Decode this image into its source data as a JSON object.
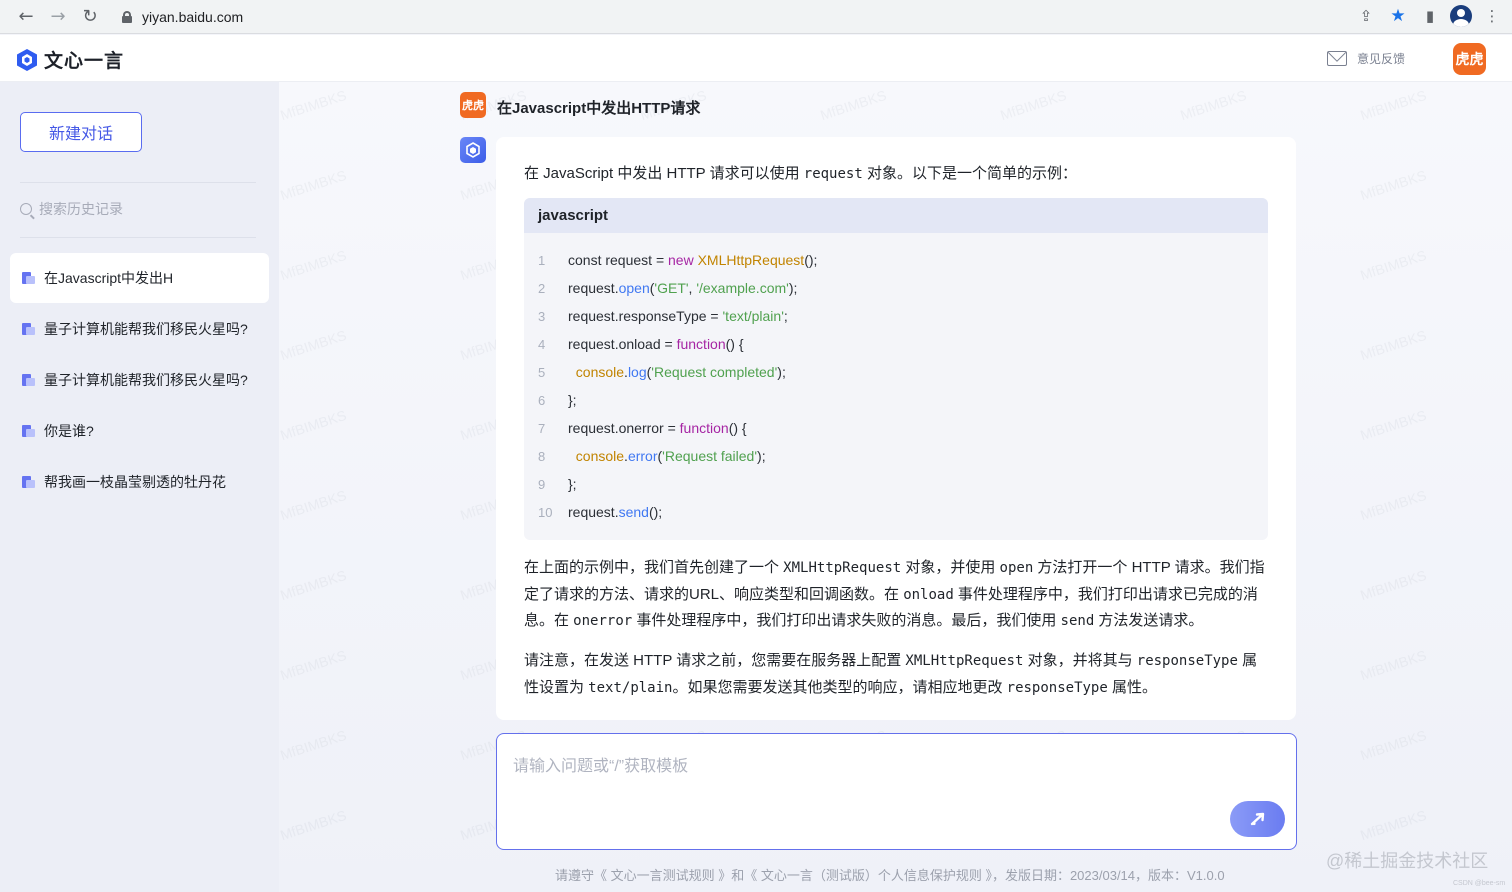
{
  "browser": {
    "url": "yiyan.baidu.com"
  },
  "header": {
    "logo_text": "文心一言",
    "feedback_label": "意见反馈",
    "avatar_text": "虎虎"
  },
  "sidebar": {
    "new_chat_label": "新建对话",
    "search_placeholder": "搜索历史记录",
    "items": [
      {
        "label": "在Javascript中发出H"
      },
      {
        "label": "量子计算机能帮我们移民火星吗?"
      },
      {
        "label": "量子计算机能帮我们移民火星吗?"
      },
      {
        "label": "你是谁?"
      },
      {
        "label": "帮我画一枝晶莹剔透的牡丹花"
      }
    ]
  },
  "conversation": {
    "question": "在Javascript中发出HTTP请求",
    "user_avatar_text": "虎虎",
    "answer": {
      "intro_a": "在 JavaScript 中发出 HTTP 请求可以使用 ",
      "intro_code": "request",
      "intro_b": " 对象。以下是一个简单的示例：",
      "code_lang": "javascript",
      "code_lines": [
        {
          "num": "1",
          "parts": [
            {
              "t": "const request = ",
              "c": ""
            },
            {
              "t": "new",
              "c": "kw"
            },
            {
              "t": " ",
              "c": ""
            },
            {
              "t": "XMLHttpRequest",
              "c": "cls"
            },
            {
              "t": "();",
              "c": ""
            }
          ]
        },
        {
          "num": "2",
          "parts": [
            {
              "t": "request.",
              "c": ""
            },
            {
              "t": "open",
              "c": "fn"
            },
            {
              "t": "(",
              "c": ""
            },
            {
              "t": "'GET'",
              "c": "str"
            },
            {
              "t": ", ",
              "c": ""
            },
            {
              "t": "'/example.com'",
              "c": "str"
            },
            {
              "t": ");",
              "c": ""
            }
          ]
        },
        {
          "num": "3",
          "parts": [
            {
              "t": "request.responseType = ",
              "c": ""
            },
            {
              "t": "'text/plain'",
              "c": "str"
            },
            {
              "t": ";",
              "c": ""
            }
          ]
        },
        {
          "num": "4",
          "parts": [
            {
              "t": "request.onload = ",
              "c": ""
            },
            {
              "t": "function",
              "c": "kw"
            },
            {
              "t": "() {",
              "c": ""
            }
          ]
        },
        {
          "num": "5",
          "parts": [
            {
              "t": "  ",
              "c": ""
            },
            {
              "t": "console",
              "c": "obj"
            },
            {
              "t": ".",
              "c": ""
            },
            {
              "t": "log",
              "c": "fn"
            },
            {
              "t": "(",
              "c": ""
            },
            {
              "t": "'Request completed'",
              "c": "str"
            },
            {
              "t": ");",
              "c": ""
            }
          ]
        },
        {
          "num": "6",
          "parts": [
            {
              "t": "};",
              "c": ""
            }
          ]
        },
        {
          "num": "7",
          "parts": [
            {
              "t": "request.onerror = ",
              "c": ""
            },
            {
              "t": "function",
              "c": "kw"
            },
            {
              "t": "() {",
              "c": ""
            }
          ]
        },
        {
          "num": "8",
          "parts": [
            {
              "t": "  ",
              "c": ""
            },
            {
              "t": "console",
              "c": "obj"
            },
            {
              "t": ".",
              "c": ""
            },
            {
              "t": "error",
              "c": "fn"
            },
            {
              "t": "(",
              "c": ""
            },
            {
              "t": "'Request failed'",
              "c": "str"
            },
            {
              "t": ");",
              "c": ""
            }
          ]
        },
        {
          "num": "9",
          "parts": [
            {
              "t": "};",
              "c": ""
            }
          ]
        },
        {
          "num": "10",
          "parts": [
            {
              "t": "request.",
              "c": ""
            },
            {
              "t": "send",
              "c": "fn"
            },
            {
              "t": "();",
              "c": ""
            }
          ]
        }
      ],
      "para1": [
        {
          "t": "在上面的示例中，我们首先创建了一个 ",
          "m": false
        },
        {
          "t": "XMLHttpRequest",
          "m": true
        },
        {
          "t": " 对象，并使用 ",
          "m": false
        },
        {
          "t": "open",
          "m": true
        },
        {
          "t": " 方法打开一个 HTTP 请求。我们指定了请求的方法、请求的URL、响应类型和回调函数。在 ",
          "m": false
        },
        {
          "t": "onload",
          "m": true
        },
        {
          "t": " 事件处理程序中，我们打印出请求已完成的消息。在 ",
          "m": false
        },
        {
          "t": "onerror",
          "m": true
        },
        {
          "t": " 事件处理程序中，我们打印出请求失败的消息。最后，我们使用 ",
          "m": false
        },
        {
          "t": "send",
          "m": true
        },
        {
          "t": " 方法发送请求。",
          "m": false
        }
      ],
      "para2": [
        {
          "t": "请注意，在发送 HTTP 请求之前，您需要在服务器上配置 ",
          "m": false
        },
        {
          "t": "XMLHttpRequest",
          "m": true
        },
        {
          "t": " 对象，并将其与 ",
          "m": false
        },
        {
          "t": "responseType",
          "m": true
        },
        {
          "t": " 属性设置为 ",
          "m": false
        },
        {
          "t": "text/plain",
          "m": true
        },
        {
          "t": "。如果您需要发送其他类型的响应，请相应地更改 ",
          "m": false
        },
        {
          "t": "responseType",
          "m": true
        },
        {
          "t": " 属性。",
          "m": false
        }
      ]
    }
  },
  "input": {
    "placeholder": "请输入问题或“/”获取模板"
  },
  "footer": {
    "text": "请遵守《 文心一言测试规则 》和《 文心一言（测试版）个人信息保护规则 》，发版日期：2023/03/14，版本：V1.0.0"
  },
  "overlay": {
    "watermark": "@稀土掘金技术社区",
    "watermark_small": "CSDN @bee-sm",
    "tile_text": "MfBIMBKS"
  }
}
